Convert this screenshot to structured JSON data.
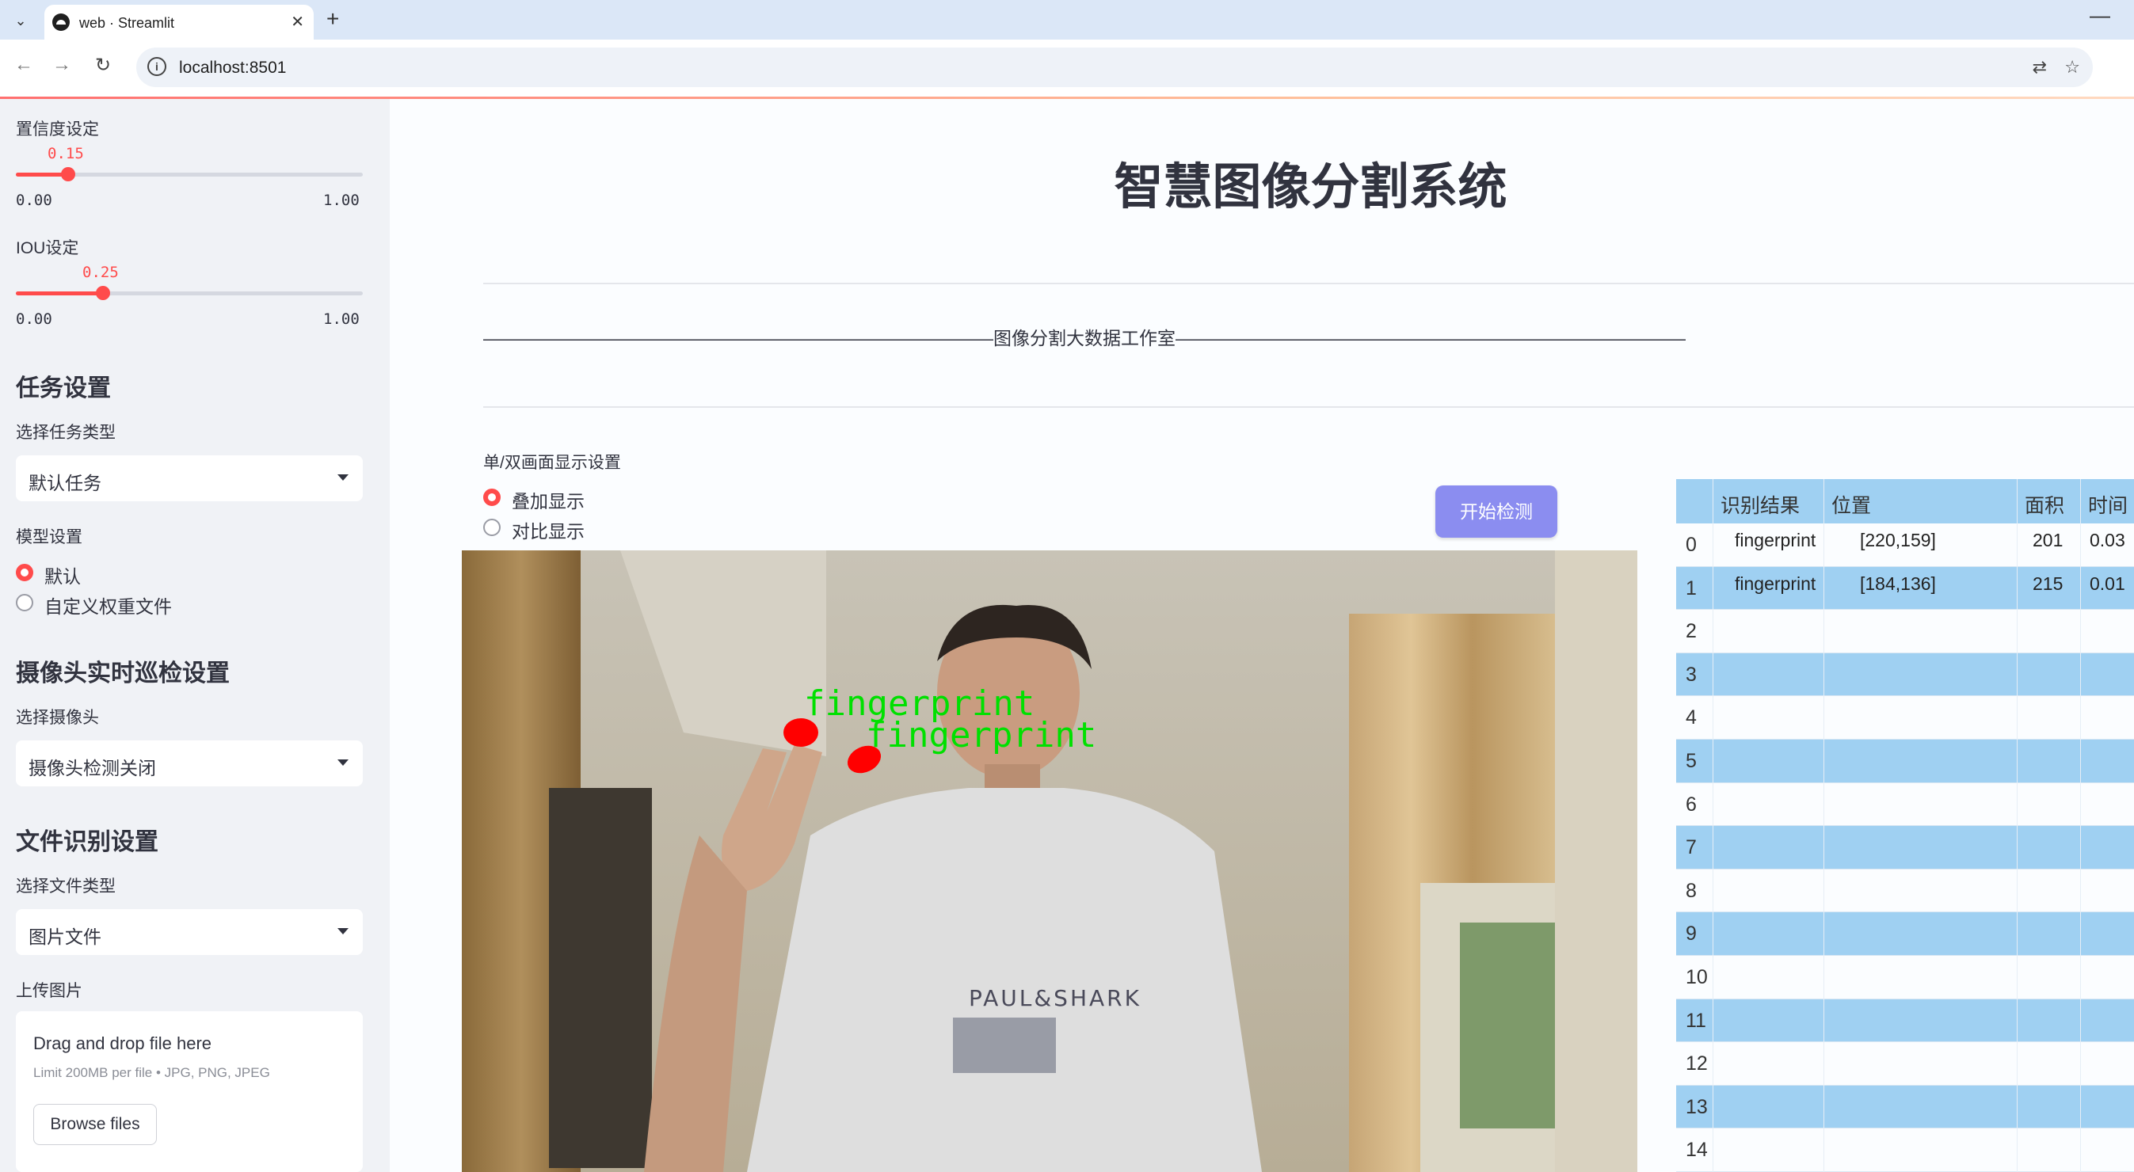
{
  "browser": {
    "tab_title": "web · Streamlit",
    "url": "localhost:8501"
  },
  "sidebar": {
    "confidence": {
      "label": "置信度设定",
      "value": "0.15",
      "min": "0.00",
      "max": "1.00",
      "fraction": 0.15
    },
    "iou": {
      "label": "IOU设定",
      "value": "0.25",
      "min": "0.00",
      "max": "1.00",
      "fraction": 0.25
    },
    "task_header": "任务设置",
    "task_type_label": "选择任务类型",
    "task_type_value": "默认任务",
    "model_label": "模型设置",
    "model_options": [
      "默认",
      "自定义权重文件"
    ],
    "model_selected": 0,
    "camera_header": "摄像头实时巡检设置",
    "camera_label": "选择摄像头",
    "camera_value": "摄像头检测关闭",
    "file_header": "文件识别设置",
    "file_type_label": "选择文件类型",
    "file_type_value": "图片文件",
    "upload_label": "上传图片",
    "upload_title": "Drag and drop file here",
    "upload_limit": "Limit 200MB per file • JPG, PNG, JPEG",
    "browse_label": "Browse files"
  },
  "main": {
    "title": "智慧图像分割系统",
    "divider_text": "————————————————————————————图像分割大数据工作室————————————————————————————",
    "display_label": "单/双画面显示设置",
    "display_options": [
      "叠加显示",
      "对比显示"
    ],
    "display_selected": 0,
    "start_button": "开始检测",
    "detections": [
      {
        "label": "fingerprint"
      },
      {
        "label": "fingerprint"
      }
    ]
  },
  "table": {
    "columns": [
      "识别结果",
      "位置",
      "面积",
      "时间"
    ],
    "rows": [
      {
        "idx": "0",
        "result": "fingerprint",
        "pos": "[220,159]",
        "area": "201",
        "time": "0.03"
      },
      {
        "idx": "1",
        "result": "fingerprint",
        "pos": "[184,136]",
        "area": "215",
        "time": "0.01"
      },
      {
        "idx": "2",
        "result": "",
        "pos": "",
        "area": "",
        "time": ""
      },
      {
        "idx": "3",
        "result": "",
        "pos": "",
        "area": "",
        "time": ""
      },
      {
        "idx": "4",
        "result": "",
        "pos": "",
        "area": "",
        "time": ""
      },
      {
        "idx": "5",
        "result": "",
        "pos": "",
        "area": "",
        "time": ""
      },
      {
        "idx": "6",
        "result": "",
        "pos": "",
        "area": "",
        "time": ""
      },
      {
        "idx": "7",
        "result": "",
        "pos": "",
        "area": "",
        "time": ""
      },
      {
        "idx": "8",
        "result": "",
        "pos": "",
        "area": "",
        "time": ""
      },
      {
        "idx": "9",
        "result": "",
        "pos": "",
        "area": "",
        "time": ""
      },
      {
        "idx": "10",
        "result": "",
        "pos": "",
        "area": "",
        "time": ""
      },
      {
        "idx": "11",
        "result": "",
        "pos": "",
        "area": "",
        "time": ""
      },
      {
        "idx": "12",
        "result": "",
        "pos": "",
        "area": "",
        "time": ""
      },
      {
        "idx": "13",
        "result": "",
        "pos": "",
        "area": "",
        "time": ""
      },
      {
        "idx": "14",
        "result": "",
        "pos": "",
        "area": "",
        "time": ""
      }
    ]
  },
  "colors": {
    "accent": "#ff4b4b",
    "button": "#8b8df0",
    "table_band": "#9fd0f2",
    "detect_text": "#00e000",
    "detect_mask": "#ff0000"
  }
}
